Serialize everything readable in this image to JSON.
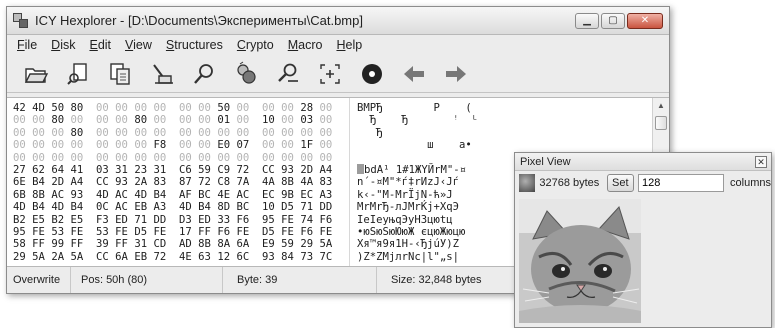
{
  "window": {
    "title": "ICY Hexplorer - [D:\\Documents\\Эксперименты\\Cat.bmp]",
    "controls": {
      "minimize": "▁",
      "maximize": "▢",
      "close": "✕"
    }
  },
  "menu": [
    {
      "label": "File",
      "accel": "F",
      "rest": "ile"
    },
    {
      "label": "Disk",
      "accel": "D",
      "rest": "isk"
    },
    {
      "label": "Edit",
      "accel": "E",
      "rest": "dit"
    },
    {
      "label": "View",
      "accel": "V",
      "rest": "iew"
    },
    {
      "label": "Structures",
      "accel": "S",
      "rest": "tructures"
    },
    {
      "label": "Crypto",
      "accel": "C",
      "rest": "rypto"
    },
    {
      "label": "Macro",
      "accel": "M",
      "rest": "acro"
    },
    {
      "label": "Help",
      "accel": "H",
      "rest": "elp"
    }
  ],
  "toolbar": [
    "open-folder-icon",
    "find-file-icon",
    "copy-document-icon",
    "clear-icon",
    "search-icon",
    "compare-icon",
    "replace-icon",
    "goto-offset-icon",
    "disk-icon",
    "back-arrow-icon",
    "forward-arrow-icon"
  ],
  "hex_rows": [
    "42 4D 50 80  00 00 00 00  00 00 50 00  00 00 28 00",
    "00 00 80 00  00 00 80 00  00 00 01 00  10 00 03 00",
    "00 00 00 80  00 00 00 00  00 00 00 00  00 00 00 00",
    "00 00 00 00  00 00 00 F8  00 00 E0 07  00 00 1F 00",
    "00 00 00 00  00 00 00 00  00 00 00 00  00 00 00 00",
    "27 62 64 41  03 31 23 31  C6 59 C9 72  CC 93 2D A4",
    "6E B4 2D A4  CC 93 2A 83  87 72 C8 7A  4A 8B 4A 83",
    "6B 8B AC 93  4D AC 4D B4  AF BC 4E AC  EC 9B EC A3",
    "4D B4 4D B4  0C AC EB A3  4D B4 8D BC  10 D5 71 DD",
    "B2 E5 B2 E5  F3 ED 71 DD  D3 ED 33 F6  95 FE 74 F6",
    "95 FE 53 FE  53 FE D5 FE  17 FF F6 FE  D5 FE F6 FE",
    "58 FF 99 FF  39 FF 31 CD  AD 8B 8A 6A  E9 59 29 5A",
    "29 5A 2A 5A  CC 6A EB 72  4E 63 12 6C  93 84 73 7C"
  ],
  "text_rows": [
    "BMPЂ        P    (",
    "  Ђ    Ђ       ꜝ  ᴸ",
    "   Ђ",
    "           ш    а•",
    "",
    "bdA¹ 1#1ЖYЙrМ\"-¤",
    "n´-¤М\"*ѓ‡rИzJ‹Jѓ",
    "k‹-\"M-MrЇjN-ћ»J",
    "MrMrЂ-лJMrЌј+XqЭ",
    "IeIeуњqЭуН3цюtц",
    "•юSюSюЮюЖ єцюЖюцю",
    "Xя™я9я1Н-‹ЂjúУ)Z",
    ")Z*ZМjлrNc|l\"„s|"
  ],
  "status": {
    "mode": "Overwrite",
    "pos": "Pos: 50h (80)",
    "byte": "Byte: 39",
    "size": "Size: 32,848 bytes"
  },
  "pixel_view": {
    "title": "Pixel View",
    "bytes": "32768 bytes",
    "set_label": "Set",
    "columns_value": "128",
    "columns_label": "columns"
  }
}
